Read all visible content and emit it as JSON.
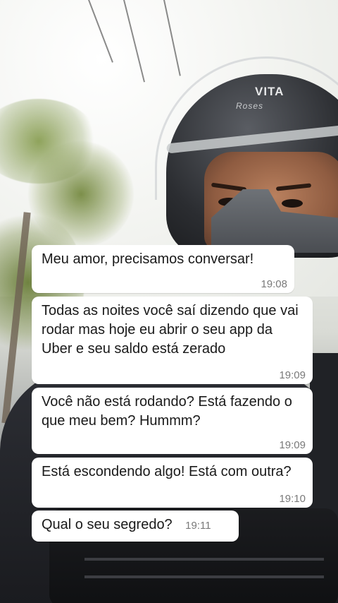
{
  "helmet": {
    "brand": "VITA",
    "model": "Roses"
  },
  "messages": [
    {
      "text": "Meu amor, precisamos conversar!",
      "time": "19:08"
    },
    {
      "text": "Todas as noites você saí dizendo que vai rodar mas hoje eu abrir o seu app da Uber e seu saldo está zerado",
      "time": "19:09"
    },
    {
      "text": "Você não está rodando? Está fazendo o que meu bem? Hummm?",
      "time": "19:09"
    },
    {
      "text": "Está escondendo algo! Está com outra?",
      "time": "19:10"
    },
    {
      "text": "Qual o seu segredo?",
      "time": "19:11"
    }
  ],
  "colors": {
    "bubble": "#ffffff",
    "timestamp": "#7a7a7a",
    "text": "#1a1a1a"
  }
}
